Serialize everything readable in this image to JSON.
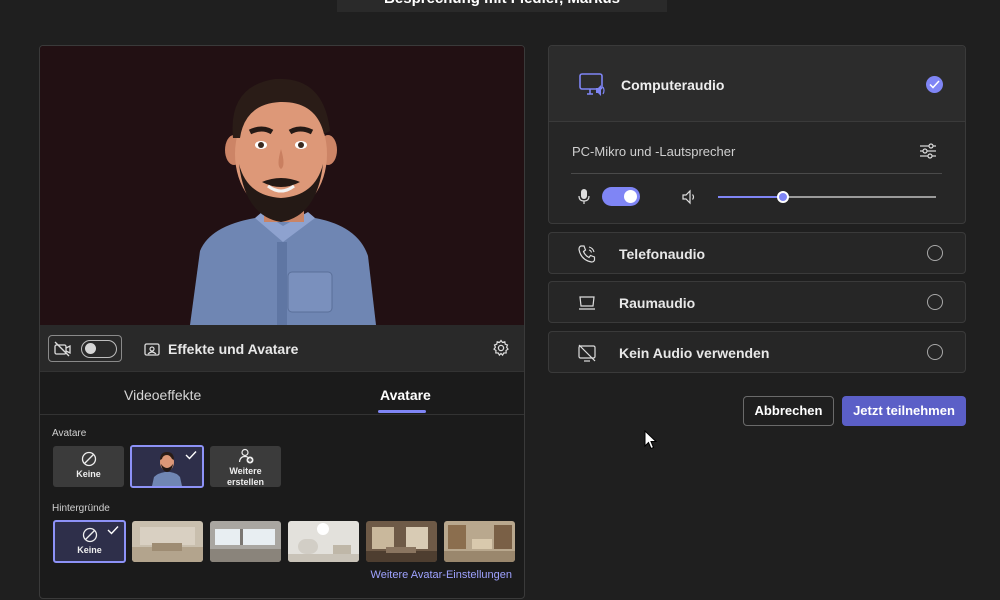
{
  "meeting": {
    "title": "Besprechung mit Fiedler, Markus"
  },
  "video_panel": {
    "effects_label": "Effekte und Avatare",
    "camera_on": false
  },
  "tabs": [
    {
      "label": "Videoeffekte",
      "active": false
    },
    {
      "label": "Avatare",
      "active": true
    }
  ],
  "avatars": {
    "section_label": "Avatare",
    "items": [
      {
        "label": "Keine",
        "selected": false
      },
      {
        "label": "",
        "selected": true
      },
      {
        "label": "Weitere erstellen",
        "selected": false
      }
    ]
  },
  "backgrounds": {
    "section_label": "Hintergründe",
    "none_label": "Keine",
    "none_selected": true
  },
  "more_settings_link": "Weitere Avatar-Einstellungen",
  "audio": {
    "computer_audio": {
      "label": "Computeraudio",
      "selected": true
    },
    "device_label": "PC-Mikro und -Lautsprecher",
    "mic_enabled": true,
    "volume_fraction": 0.3,
    "options": [
      {
        "label": "Telefonaudio",
        "icon": "phone-icon",
        "selected": false
      },
      {
        "label": "Raumaudio",
        "icon": "room-device-icon",
        "selected": false
      },
      {
        "label": "Kein Audio verwenden",
        "icon": "no-audio-icon",
        "selected": false
      }
    ]
  },
  "buttons": {
    "cancel": "Abbrechen",
    "join": "Jetzt teilnehmen"
  },
  "colors": {
    "accent": "#7f85f5",
    "primary_button": "#5b5fc7",
    "background": "#1f1f1f"
  }
}
